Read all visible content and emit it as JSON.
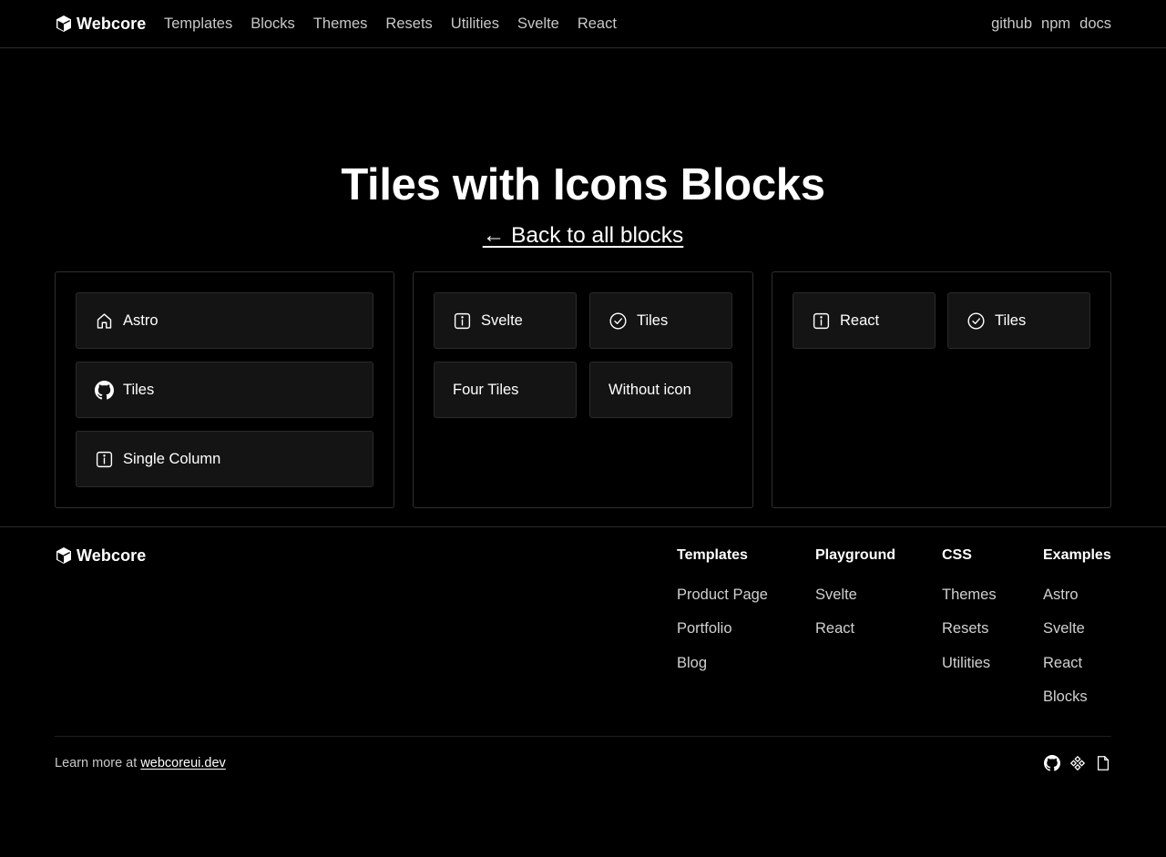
{
  "header": {
    "logo_text": "Webcore",
    "nav": [
      "Templates",
      "Blocks",
      "Themes",
      "Resets",
      "Utilities",
      "Svelte",
      "React"
    ],
    "nav_right": [
      "github",
      "npm",
      "docs"
    ]
  },
  "hero": {
    "title": "Tiles with Icons Blocks",
    "back_link": "← Back to all blocks"
  },
  "panels": [
    {
      "tiles": [
        {
          "label": "Astro",
          "icon": "home-icon"
        },
        {
          "label": "Tiles",
          "icon": "github-icon"
        },
        {
          "label": "Single Column",
          "icon": "info-icon"
        }
      ]
    },
    {
      "tiles": [
        {
          "label": "Svelte",
          "icon": "info-icon"
        },
        {
          "label": "Tiles",
          "icon": "check-circle-icon"
        },
        {
          "label": "Four Tiles",
          "icon": ""
        },
        {
          "label": "Without icon",
          "icon": ""
        }
      ]
    },
    {
      "tiles": [
        {
          "label": "React",
          "icon": "info-icon"
        },
        {
          "label": "Tiles",
          "icon": "check-circle-icon"
        }
      ]
    }
  ],
  "footer": {
    "logo_text": "Webcore",
    "columns": [
      {
        "title": "Templates",
        "links": [
          "Product Page",
          "Portfolio",
          "Blog"
        ]
      },
      {
        "title": "Playground",
        "links": [
          "Svelte",
          "React"
        ]
      },
      {
        "title": "CSS",
        "links": [
          "Themes",
          "Resets",
          "Utilities"
        ]
      },
      {
        "title": "Examples",
        "links": [
          "Astro",
          "Svelte",
          "React",
          "Blocks"
        ]
      }
    ],
    "learn_prefix": "Learn more at",
    "learn_link": "webcoreui.dev",
    "social_icons": [
      "github-icon",
      "npm-icon",
      "docs-icon"
    ]
  },
  "colors": {
    "background": "#000000",
    "tile_background": "#141414",
    "border": "#2e2e2e",
    "text": "#ffffff",
    "muted_text": "#c8c8c8"
  }
}
